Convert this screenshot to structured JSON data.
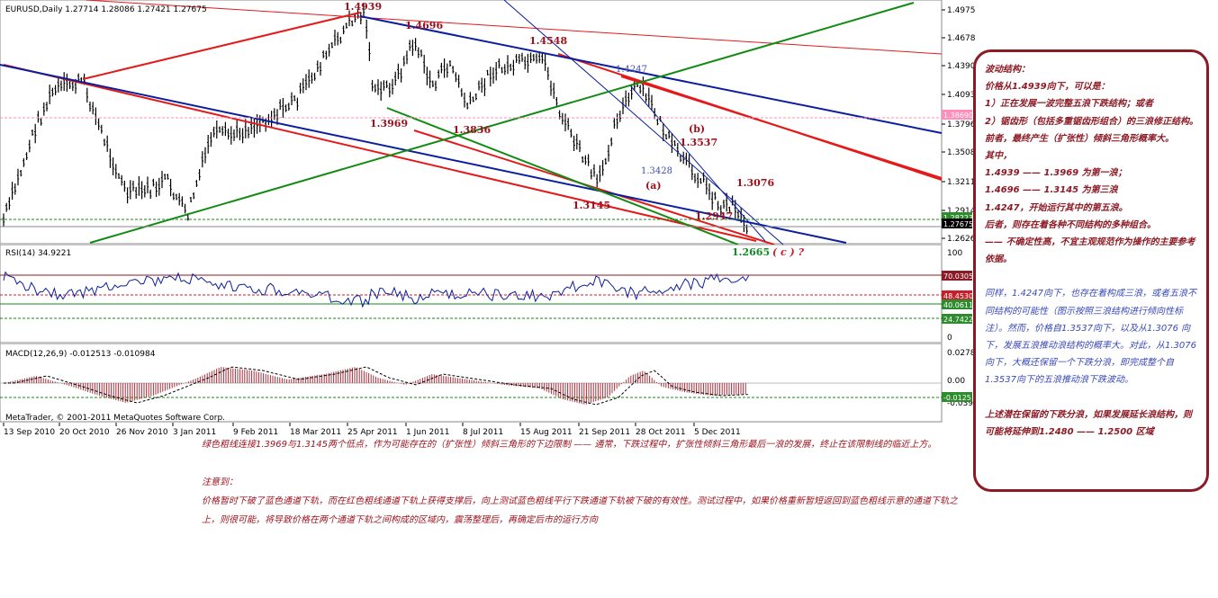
{
  "chart": {
    "symbol_header": "EURUSD,Daily  1.27714 1.28086 1.27421 1.27675",
    "price_axis": [
      "1.49750",
      "1.46780",
      "1.43900",
      "1.40930",
      "1.37960",
      "1.35080",
      "1.32110",
      "1.29140",
      "1.26260"
    ],
    "price_tags": [
      {
        "label": "1.38690",
        "bg": "#ff8fb8"
      },
      {
        "label": "1.28223",
        "bg": "#2e8b2e"
      },
      {
        "label": "1.27675",
        "bg": "#000000"
      }
    ],
    "wave_labels_red": [
      "1.4939",
      "1.4696",
      "1.4548",
      "1.3969",
      "1.3836",
      "1.3537",
      "(b)",
      "(a)",
      "1.3145",
      "1.3076",
      "1.2947"
    ],
    "wave_labels_blue": [
      "1.4247",
      "1.3428"
    ],
    "wave_labels_green": [
      "1.2665"
    ],
    "wave_label_c": "( c )  ?",
    "date_axis": [
      "13 Sep 2010",
      "20 Oct 2010",
      "26 Nov 2010",
      "3 Jan 2011",
      "9 Feb 2011",
      "18 Mar 2011",
      "25 Apr 2011",
      "1 Jun 2011",
      "8 Jul 2011",
      "15 Aug 2011",
      "21 Sep 2011",
      "28 Oct 2011",
      "5 Dec 2011"
    ],
    "rsi": {
      "title": "RSI(14) 34.9221",
      "axis": [
        "100",
        "0"
      ],
      "tags": [
        {
          "label": "70.0305",
          "bg": "#8c1a24"
        },
        {
          "label": "48.4530",
          "bg": "#c81e2c"
        },
        {
          "label": "40.0611",
          "bg": "#2e8b2e"
        },
        {
          "label": "24.7422",
          "bg": "#2e8b2e"
        }
      ]
    },
    "macd": {
      "title": "MACD(12,26,9) -0.012513 -0.010984",
      "axis": [
        "0.027878",
        "0.00",
        "-0.039"
      ],
      "tags": [
        {
          "label": "-0.0125",
          "bg": "#2e8b2e"
        }
      ]
    },
    "copyright": "MetaTrader, © 2001-2011 MetaQuotes Software Corp.",
    "colors": {
      "red": "#e41a1a",
      "darkred": "#9b0f1a",
      "blue": "#0a1e9e",
      "green": "#138a13",
      "candle": "#000000"
    }
  },
  "notes": {
    "para1": "绿色粗线连接1.3969与1.3145两个低点，作为可能存在的（扩张性）倾斜三角形的下边限制 —— 通常，下跌过程中，扩张性倾斜三角形最后一浪的发展，终止在该限制线的临近上方。",
    "heading": "注意到：",
    "para2": "价格暂时下破了蓝色通道下轨，而在红色粗线通道下轨上获得支撑后，向上测试蓝色粗线平行下跌通道下轨被下破的有效性。测试过程中，如果价格重新暂短返回到蓝色粗线示意的通道下轨之上，则很可能，将导致价格在两个通道下轨之间构成的区域内，震荡整理后，再确定后市的运行方向"
  },
  "side_box": {
    "red_lines": [
      "波动结构：",
      "价格从1.4939向下，可以是：",
      "1）正在发展一波完整五浪下跌结构；或者",
      "2）锯齿形（包括多重锯齿形组合）的三浪修正结构。",
      "前者，最终产生（扩张性）倾斜三角形概率大。",
      "其中，",
      "1.4939 —— 1.3969 为第一浪；",
      "1.4696 —— 1.3145 为第三浪",
      "1.4247，开始运行其中的第五浪。",
      "后者，则存在着各种不同结构的多种组合。",
      "—— 不确定性高，不宜主观规范作为操作的主要参考依据。"
    ],
    "blue_text": "同样，1.4247向下，也存在着构成三浪，或者五浪不同结构的可能性（图示按照三浪结构进行倾向性标注）。然而，价格自1.3537向下，以及从1.3076 向下，发展五浪推动浪结构的概率大。对此，从1.3076向下，大概还保留一个下跌分浪，即完成整个自1.3537向下的五浪推动浪下跌波动。",
    "red_tail": "上述潜在保留的下跌分浪，如果发展延长浪结构，则可能将延伸到1.2480 —— 1.2500 区域"
  }
}
